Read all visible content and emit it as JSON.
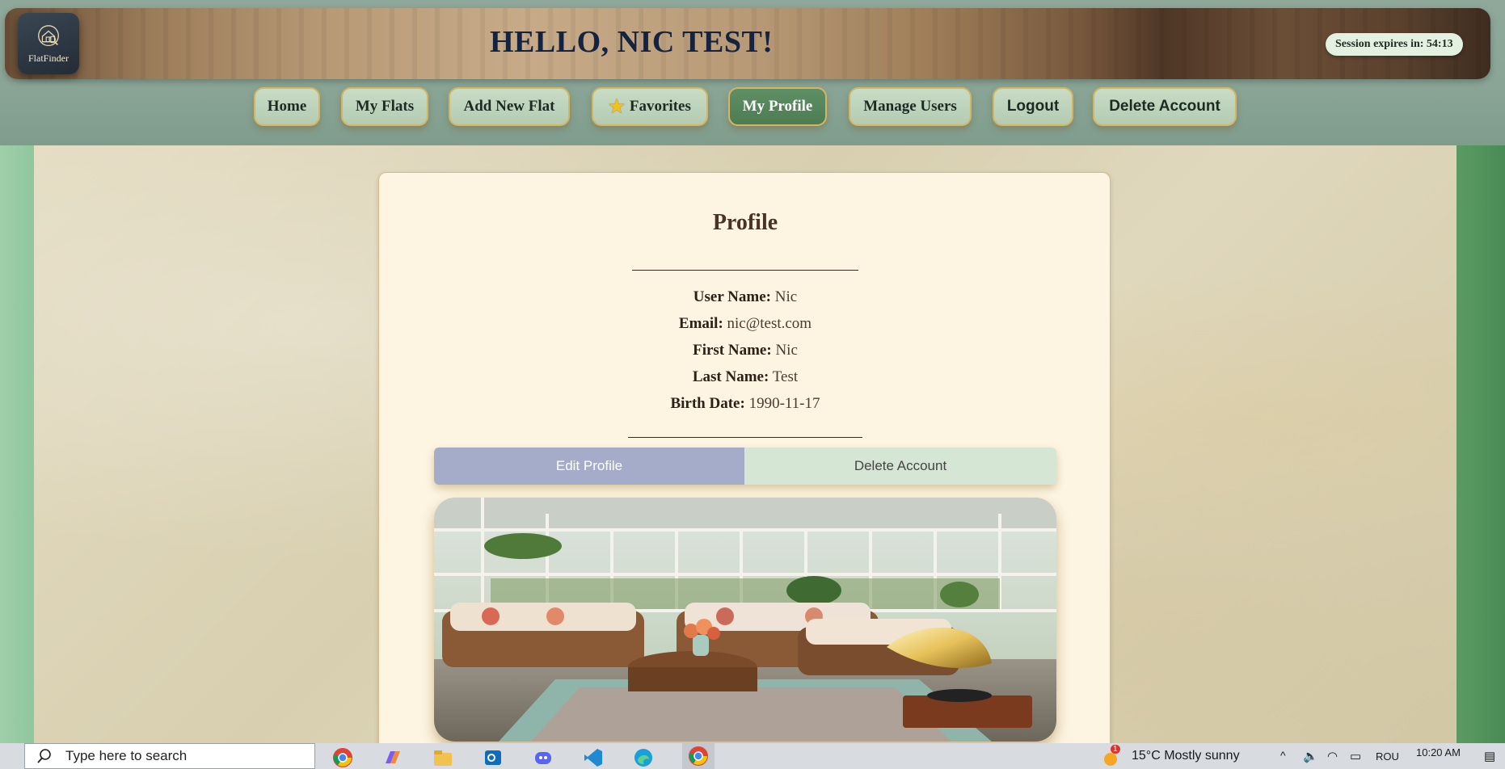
{
  "header": {
    "logo_text": "FlatFinder",
    "greeting": "HELLO, NIC TEST!",
    "session": "Session expires in: 54:13"
  },
  "nav": {
    "home": "Home",
    "my_flats": "My Flats",
    "add_new_flat": "Add New Flat",
    "favorites": "Favorites",
    "my_profile": "My Profile",
    "manage_users": "Manage Users",
    "logout": "Logout",
    "delete_account": "Delete Account",
    "active": "My Profile"
  },
  "profile": {
    "title": "Profile",
    "fields": [
      {
        "label": "User Name:",
        "value": "Nic"
      },
      {
        "label": "Email:",
        "value": "nic@test.com"
      },
      {
        "label": "First Name:",
        "value": "Nic"
      },
      {
        "label": "Last Name:",
        "value": "Test"
      },
      {
        "label": "Birth Date:",
        "value": "1990-11-17"
      }
    ],
    "edit_button": "Edit Profile",
    "delete_button": "Delete Account"
  },
  "taskbar": {
    "search_placeholder": "Type here to search",
    "weather": "15°C  Mostly sunny",
    "weather_badge": "1",
    "language": "ROU",
    "time": "10:20 AM"
  },
  "colors": {
    "active_nav": "#5f8f64",
    "edit_button": "#a4acc9",
    "delete_button": "#d5e6d5",
    "card_bg": "#fdf5e2"
  }
}
